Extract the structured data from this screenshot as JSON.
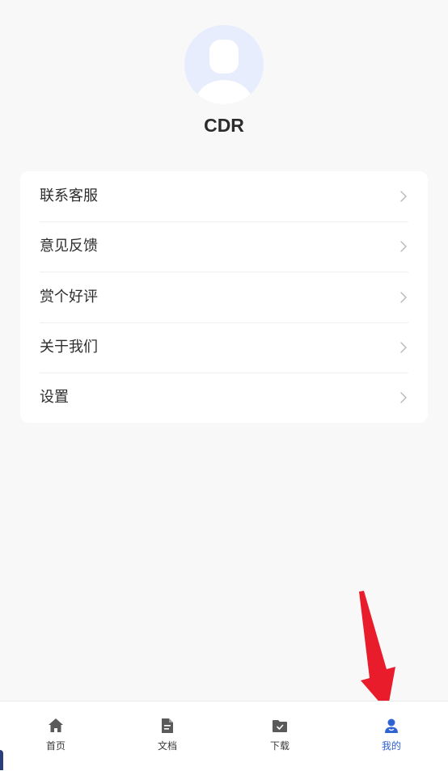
{
  "profile": {
    "avatar_icon": "user-avatar-icon",
    "username": "CDR"
  },
  "menu": {
    "items": [
      {
        "label": "联系客服",
        "icon": "chevron-right-icon"
      },
      {
        "label": "意见反馈",
        "icon": "chevron-right-icon"
      },
      {
        "label": "赏个好评",
        "icon": "chevron-right-icon"
      },
      {
        "label": "关于我们",
        "icon": "chevron-right-icon"
      },
      {
        "label": "设置",
        "icon": "chevron-right-icon"
      }
    ]
  },
  "tabbar": {
    "tabs": [
      {
        "label": "首页",
        "icon": "home-icon",
        "active": false
      },
      {
        "label": "文档",
        "icon": "document-icon",
        "active": false
      },
      {
        "label": "下载",
        "icon": "download-folder-icon",
        "active": false
      },
      {
        "label": "我的",
        "icon": "profile-icon",
        "active": true
      }
    ]
  },
  "annotation": {
    "arrow_color": "#e81c2b"
  },
  "colors": {
    "accent": "#2f63d2",
    "background": "#f8f8f9",
    "avatar_bg": "#e8edfd",
    "inactive_icon": "#5a5a5a"
  }
}
